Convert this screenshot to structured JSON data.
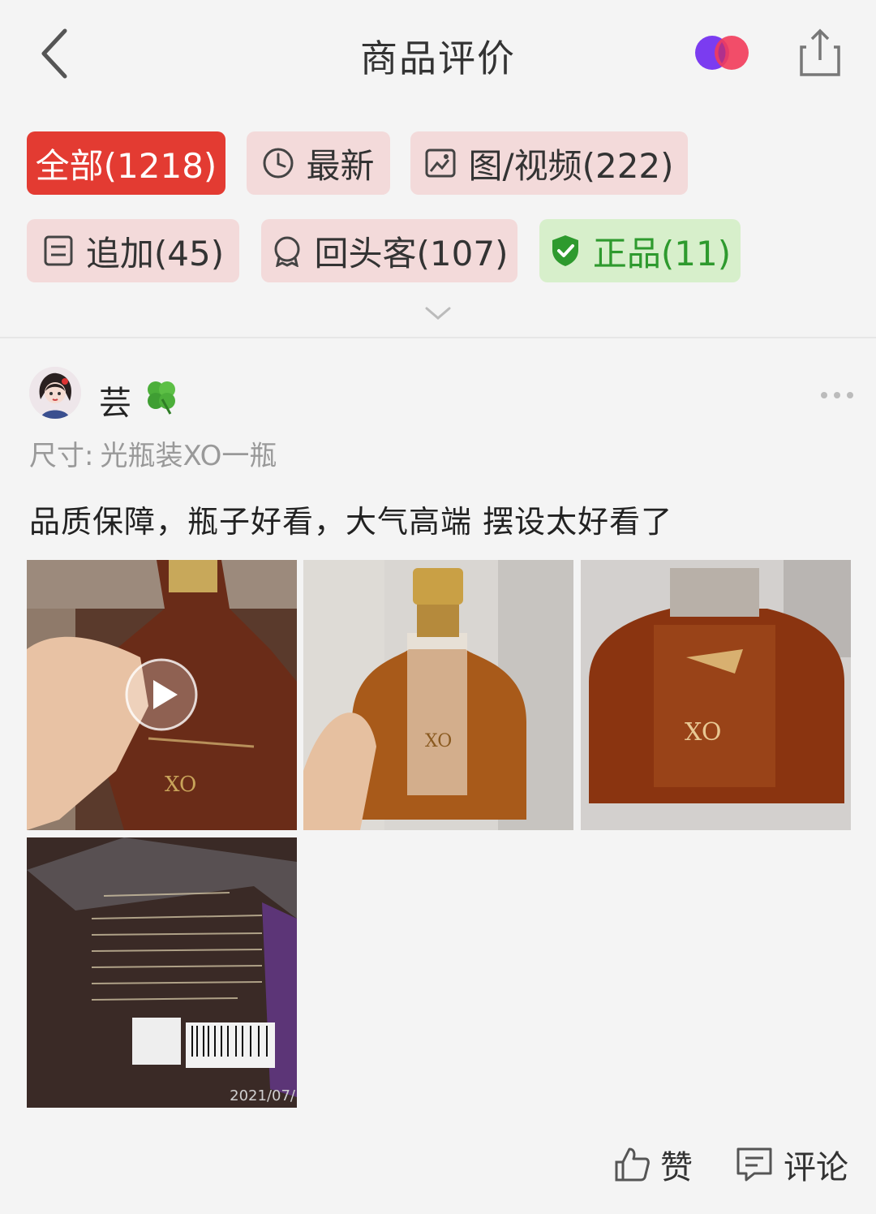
{
  "header": {
    "title": "商品评价"
  },
  "filters": {
    "row1": [
      {
        "label": "全部(1218)",
        "active": true
      },
      {
        "label": "最新",
        "icon": "clock-icon"
      },
      {
        "label": "图/视频(222)",
        "icon": "image-icon"
      }
    ],
    "row2": [
      {
        "label": "追加(45)",
        "icon": "document-icon"
      },
      {
        "label": "回头客(107)",
        "icon": "badge-icon"
      },
      {
        "label": "正品(11)",
        "icon": "shield-check-icon"
      }
    ]
  },
  "review": {
    "user_name": "芸",
    "spec_label": "尺寸:",
    "spec_value": "光瓶装XO一瓶",
    "text": "品质保障，瓶子好看，大气高端  摆设太好看了",
    "photos": [
      {
        "kind": "video-thumbnail"
      },
      {
        "kind": "bottle-front"
      },
      {
        "kind": "bottle-closeup"
      },
      {
        "kind": "back-label",
        "date_stamp": "2021/07/"
      }
    ]
  },
  "actions": {
    "like_label": "赞",
    "comment_label": "评论"
  },
  "colors": {
    "accent_red": "#e33b32",
    "chip_bg": "#f3dada",
    "genuine_green": "#2e9a2e",
    "genuine_bg": "#d7efcb"
  }
}
